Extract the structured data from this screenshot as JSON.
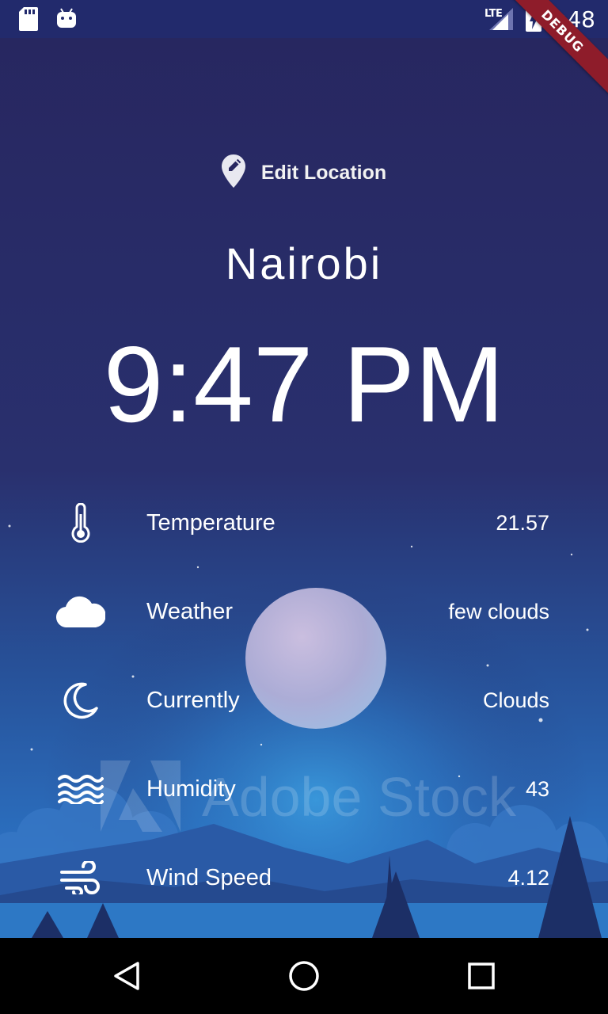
{
  "status_bar": {
    "time": "7:48",
    "network": "LTE",
    "icons": [
      "sd-card-icon",
      "android-icon",
      "signal-icon",
      "battery-charging-icon"
    ]
  },
  "debug_banner": "DEBUG",
  "edit_location": {
    "label": "Edit Location",
    "icon": "location-edit-icon"
  },
  "city": "Nairobi",
  "time": "9:47 PM",
  "watermark_text": "Adobe Stock",
  "stats": [
    {
      "label": "Temperature",
      "value": "21.57",
      "icon": "thermometer-icon"
    },
    {
      "label": "Weather",
      "value": "few clouds",
      "icon": "cloud-icon"
    },
    {
      "label": "Currently",
      "value": "Clouds",
      "icon": "moon-icon"
    },
    {
      "label": "Humidity",
      "value": "43",
      "icon": "humidity-waves-icon"
    },
    {
      "label": "Wind Speed",
      "value": "4.12",
      "icon": "wind-icon"
    }
  ],
  "nav": [
    "back-icon",
    "home-icon",
    "recents-icon"
  ],
  "colors": {
    "sky_top": "#27265f",
    "sky_bottom": "#2a6cc0",
    "status_bar": "#222a6c",
    "debug_banner": "#8e1c2a",
    "moon": "#c9c6e6"
  }
}
